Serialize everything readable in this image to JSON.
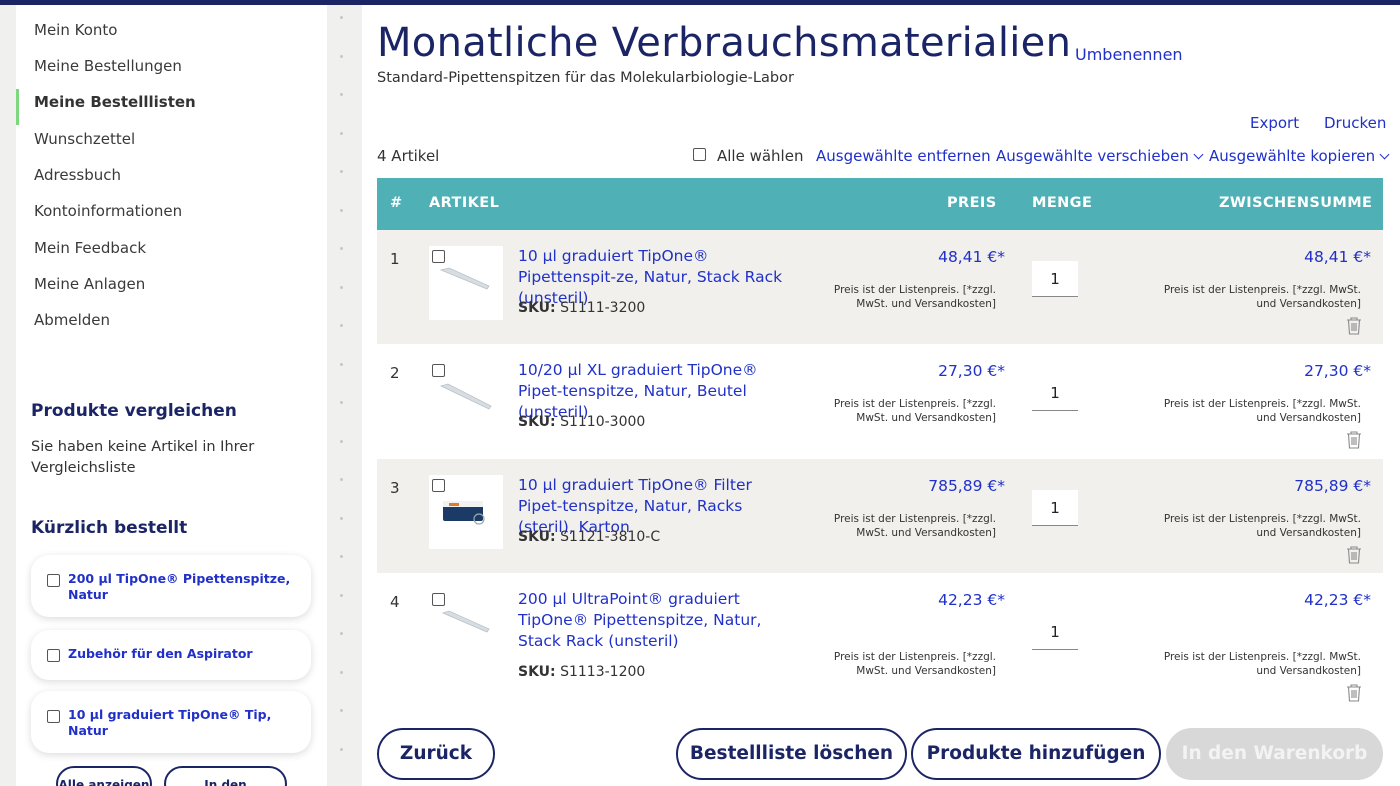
{
  "sidebar": {
    "nav": [
      "Mein Konto",
      "Meine Bestellungen",
      "Meine Bestelllisten",
      "Wunschzettel",
      "Adressbuch",
      "Kontoinformationen",
      "Mein Feedback",
      "Meine Anlagen",
      "Abmelden"
    ],
    "active_nav": "Meine Bestelllisten",
    "compare_heading": "Produkte vergleichen",
    "compare_text": "Sie haben keine Artikel in Ihrer Vergleichsliste",
    "recent_heading": "Kürzlich bestellt",
    "recent_items": [
      "200 µl TipOne® Pipettenspitze, Natur",
      "Zubehör für den Aspirator",
      "10 µl graduiert TipOne® Tip, Natur"
    ],
    "show_all": "Alle anzeigen",
    "to_cart": "In den Warenkorb"
  },
  "main": {
    "title": "Monatliche Verbrauchsmaterialien",
    "rename": "Umbenennen",
    "subtitle": "Standard-Pipettenspitzen für das Molekularbiologie-Labor",
    "export": "Export",
    "print": "Drucken",
    "count": "4 Artikel",
    "select_all": "Alle wählen",
    "remove_selected": "Ausgewählte entfernen",
    "move_selected": "Ausgewählte verschieben",
    "copy_selected": "Ausgewählte kopieren",
    "columns": {
      "num": "#",
      "item": "ARTIKEL",
      "price": "PREIS",
      "qty": "MENGE",
      "subtotal": "ZWISCHENSUMME"
    },
    "sku_label": "SKU:",
    "price_note": "Preis ist der Listenpreis. [*zzgl. MwSt. und Versandkosten]",
    "items": [
      {
        "num": "1",
        "name": "10 µl graduiert TipOne® Pipettenspit-ze, Natur, Stack Rack (unsteril)",
        "sku": "S1111-3200",
        "price": "48,41 €*",
        "qty": "1",
        "subtotal": "48,41 €*",
        "thumb": "tip-icon"
      },
      {
        "num": "2",
        "name": "10/20 µl XL graduiert TipOne® Pipet-tenspitze, Natur, Beutel (unsteril)",
        "sku": "S1110-3000",
        "price": "27,30 €*",
        "qty": "1",
        "subtotal": "27,30 €*",
        "thumb": "tip-icon"
      },
      {
        "num": "3",
        "name": "10 µl graduiert TipOne® Filter Pipet-tenspitze, Natur, Racks (steril), Karton",
        "sku": "S1121-3810-C",
        "price": "785,89 €*",
        "qty": "1",
        "subtotal": "785,89 €*",
        "thumb": "rack-box-icon"
      },
      {
        "num": "4",
        "name": "200 µl UltraPoint® graduiert TipOne® Pipettenspitze, Natur, Stack Rack (unsteril)",
        "sku": "S1113-1200",
        "price": "42,23 €*",
        "qty": "1",
        "subtotal": "42,23 €*",
        "thumb": "tip-icon"
      }
    ],
    "back": "Zurück",
    "delete_list": "Bestellliste löschen",
    "add_products": "Produkte hinzufügen",
    "add_to_cart": "In den Warenkorb"
  },
  "colors": {
    "accent": "#1b2566",
    "link": "#2030c8",
    "table_header": "#4fb0b6",
    "active_marker": "#7ed67e"
  }
}
